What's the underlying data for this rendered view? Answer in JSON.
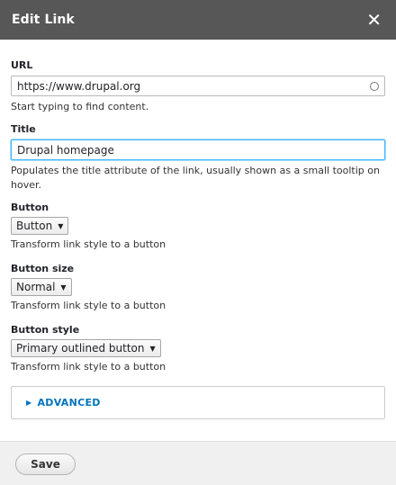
{
  "dialog": {
    "title": "Edit Link",
    "close_icon": "close-icon"
  },
  "url_field": {
    "label": "URL",
    "value": "https://www.drupal.org",
    "description": "Start typing to find content."
  },
  "title_field": {
    "label": "Title",
    "value": "Drupal homepage",
    "description": "Populates the title attribute of the link, usually shown as a small tooltip on hover."
  },
  "button_field": {
    "label": "Button",
    "selected": "Button",
    "description": "Transform link style to a button"
  },
  "button_size_field": {
    "label": "Button size",
    "selected": "Normal",
    "description": "Transform link style to a button"
  },
  "button_style_field": {
    "label": "Button style",
    "selected": "Primary outlined button",
    "description": "Transform link style to a button"
  },
  "advanced": {
    "label": "ADVANCED"
  },
  "footer": {
    "save_label": "Save"
  },
  "colors": {
    "titlebar": "#575757",
    "link": "#0074bd",
    "focus": "#40b6ff"
  }
}
